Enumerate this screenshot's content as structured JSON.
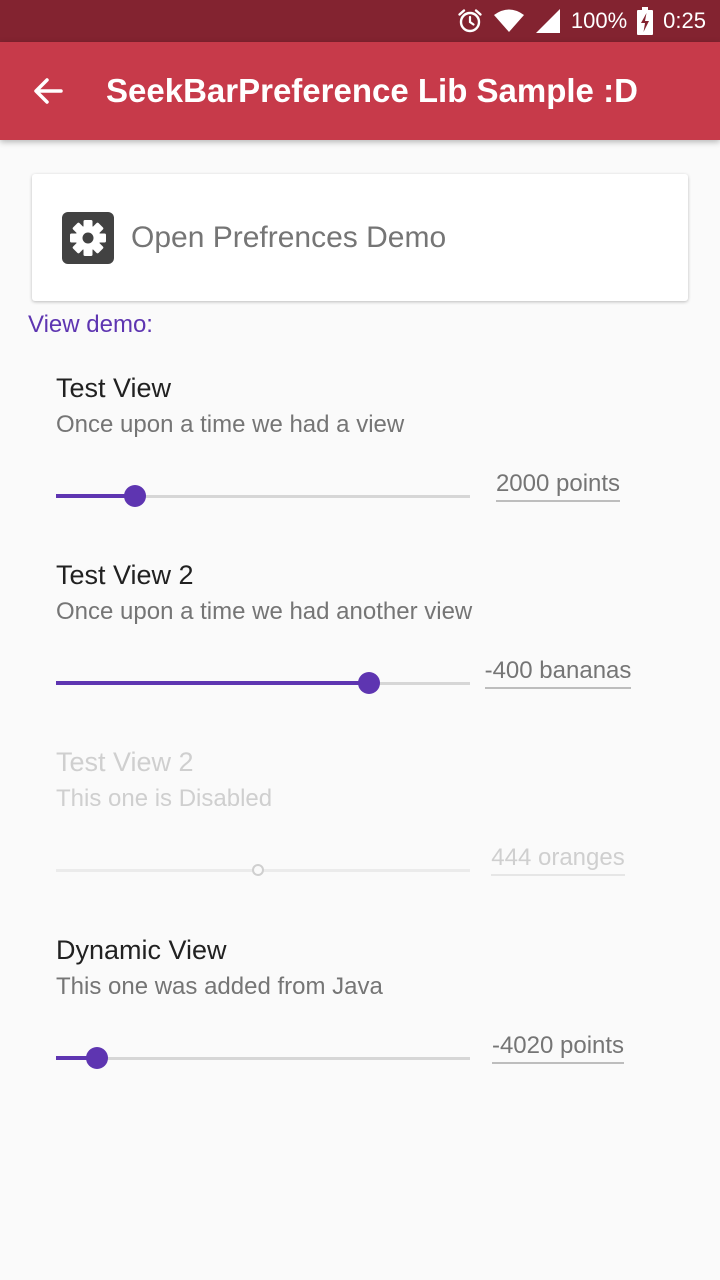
{
  "status_bar": {
    "battery_percent": "100%",
    "time": "0:25",
    "icons": [
      "alarm-icon",
      "wifi-icon",
      "signal-icon",
      "battery-charging-icon"
    ]
  },
  "app_bar": {
    "title": "SeekBarPreference Lib Sample :D",
    "back_icon": "arrow-back-icon",
    "background_color": "#c73a4a",
    "status_bar_color": "#832330"
  },
  "card": {
    "label": "Open Prefrences Demo",
    "icon": "gear-icon"
  },
  "section_label": "View demo:",
  "accent_color": "#5e35b1",
  "preferences": [
    {
      "title": "Test View",
      "summary": "Once upon a time we had a view",
      "value": "2000 points",
      "progress": 0.19,
      "enabled": true
    },
    {
      "title": "Test View 2",
      "summary": "Once upon a time we had another view",
      "value": "-400 bananas",
      "progress": 0.755,
      "enabled": true
    },
    {
      "title": "Test View 2",
      "summary": "This one is Disabled",
      "value": "444 oranges",
      "progress": 0.488,
      "enabled": false
    },
    {
      "title": "Dynamic View",
      "summary": "This one was added from Java",
      "value": "-4020 points",
      "progress": 0.099,
      "enabled": true
    }
  ]
}
